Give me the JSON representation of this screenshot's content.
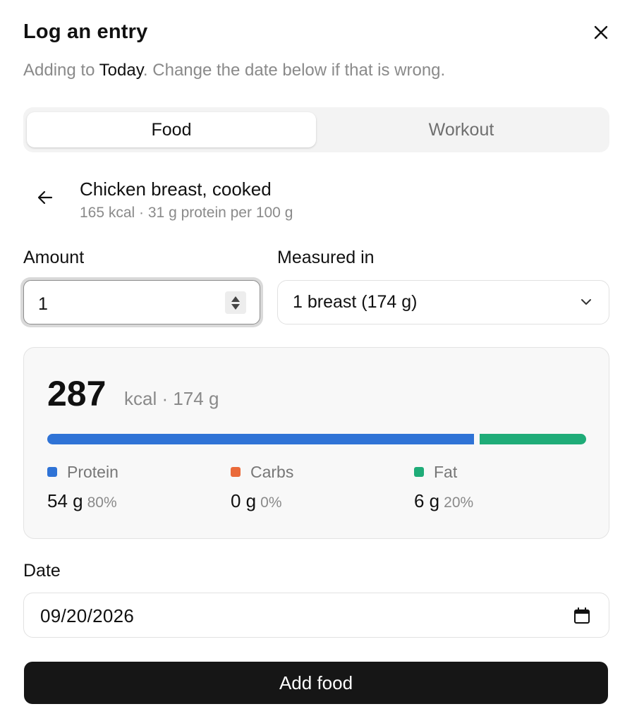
{
  "dialog": {
    "title": "Log an entry",
    "subtitle_prefix": "Adding to ",
    "subtitle_today": "Today",
    "subtitle_suffix": ". Change the date below if that is wrong."
  },
  "tabs": [
    {
      "label": "Food",
      "active": true
    },
    {
      "label": "Workout",
      "active": false
    }
  ],
  "food": {
    "name": "Chicken breast, cooked",
    "meta": "165 kcal · 31 g protein per 100 g"
  },
  "amount": {
    "label": "Amount",
    "value": "1"
  },
  "measure": {
    "label": "Measured in",
    "selected": "1 breast (174 g)"
  },
  "summary": {
    "kcal": "287",
    "unit": "kcal · 174 g",
    "macros": [
      {
        "name": "Protein",
        "grams": "54 g",
        "percent": "80%",
        "fraction": 0.8,
        "color": "#2f73d6"
      },
      {
        "name": "Carbs",
        "grams": "0 g",
        "percent": "0%",
        "fraction": 0.0,
        "color": "#ea6a3a"
      },
      {
        "name": "Fat",
        "grams": "6 g",
        "percent": "20%",
        "fraction": 0.2,
        "color": "#1fac78"
      }
    ]
  },
  "date": {
    "label": "Date",
    "value": "09/20/2026"
  },
  "submit": {
    "label": "Add food"
  },
  "icons": {
    "close": "close-icon",
    "back": "arrow-left-icon",
    "dropdown": "chevron-down-icon",
    "calendar": "calendar-icon"
  }
}
